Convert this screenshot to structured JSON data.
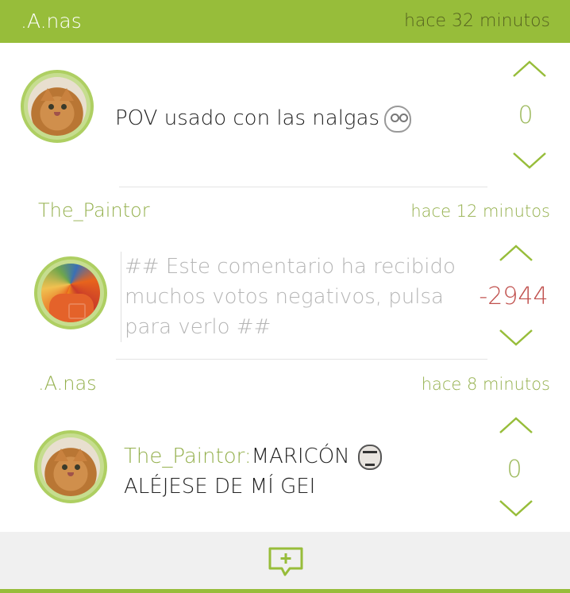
{
  "header": {
    "author": ".A.nas",
    "time": "hace 32 minutos"
  },
  "post": {
    "text": "POV usado con las nalgas",
    "emoji": "derp-face-icon",
    "score": "0"
  },
  "comments": [
    {
      "author": "The_Paintor",
      "time": "hace 12 minutos",
      "text": "## Este comentario ha recibido muchos votos negativos, pulsa para verlo ##",
      "score": "-2944"
    },
    {
      "author": ".A.nas",
      "time": "hace 8 minutos",
      "mention": "The_Paintor:",
      "text": "MARICÓN",
      "text2": "ALÉJESE DE MÍ GEI",
      "score": "0"
    }
  ],
  "colors": {
    "accent": "#97bd3a",
    "text_green": "#94b04d",
    "negative": "#c0504d"
  },
  "icons": {
    "upvote": "chevron-up-icon",
    "downvote": "chevron-down-icon",
    "add_comment": "add-comment-icon"
  }
}
